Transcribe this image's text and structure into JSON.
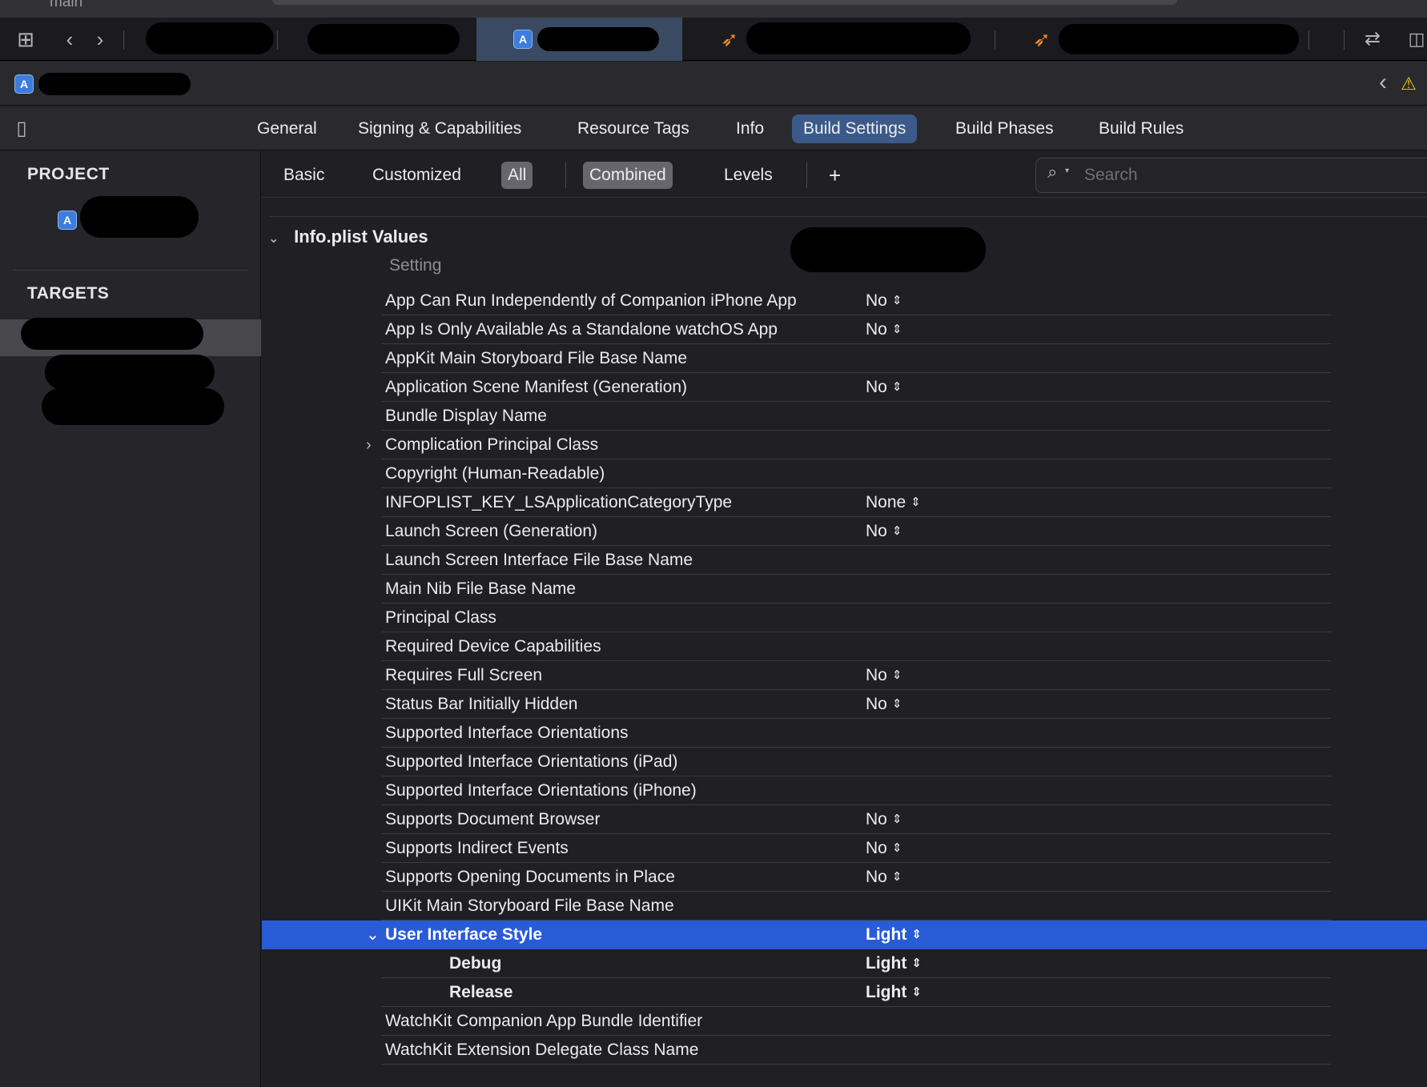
{
  "window": {
    "branch": "main"
  },
  "editor_tabs": [
    {
      "label": "General",
      "selected": false
    },
    {
      "label": "Signing & Capabilities",
      "selected": false
    },
    {
      "label": "Resource Tags",
      "selected": false
    },
    {
      "label": "Info",
      "selected": false
    },
    {
      "label": "Build Settings",
      "selected": true
    },
    {
      "label": "Build Phases",
      "selected": false
    },
    {
      "label": "Build Rules",
      "selected": false
    }
  ],
  "sidebar": {
    "project_header": "PROJECT",
    "targets_header": "TARGETS"
  },
  "filters": {
    "basic": "Basic",
    "customized": "Customized",
    "all": "All",
    "combined": "Combined",
    "levels": "Levels",
    "add": "+",
    "selected_scope": "All",
    "selected_view": "Combined"
  },
  "search": {
    "placeholder": "Search",
    "value": ""
  },
  "group": {
    "title": "Info.plist Values",
    "column_header": "Setting"
  },
  "settings": [
    {
      "name": "App Can Run Independently of Companion iPhone App",
      "value": "No"
    },
    {
      "name": "App Is Only Available As a Standalone watchOS App",
      "value": "No"
    },
    {
      "name": "AppKit Main Storyboard File Base Name",
      "value": ""
    },
    {
      "name": "Application Scene Manifest (Generation)",
      "value": "No"
    },
    {
      "name": "Bundle Display Name",
      "value": ""
    },
    {
      "name": "Complication Principal Class",
      "value": "",
      "expandable": true
    },
    {
      "name": "Copyright (Human-Readable)",
      "value": ""
    },
    {
      "name": "INFOPLIST_KEY_LSApplicationCategoryType",
      "value": "None"
    },
    {
      "name": "Launch Screen (Generation)",
      "value": "No"
    },
    {
      "name": "Launch Screen Interface File Base Name",
      "value": ""
    },
    {
      "name": "Main Nib File Base Name",
      "value": ""
    },
    {
      "name": "Principal Class",
      "value": ""
    },
    {
      "name": "Required Device Capabilities",
      "value": ""
    },
    {
      "name": "Requires Full Screen",
      "value": "No"
    },
    {
      "name": "Status Bar Initially Hidden",
      "value": "No"
    },
    {
      "name": "Supported Interface Orientations",
      "value": ""
    },
    {
      "name": "Supported Interface Orientations (iPad)",
      "value": ""
    },
    {
      "name": "Supported Interface Orientations (iPhone)",
      "value": ""
    },
    {
      "name": "Supports Document Browser",
      "value": "No"
    },
    {
      "name": "Supports Indirect Events",
      "value": "No"
    },
    {
      "name": "Supports Opening Documents in Place",
      "value": "No"
    },
    {
      "name": "UIKit Main Storyboard File Base Name",
      "value": ""
    },
    {
      "name": "User Interface Style",
      "value": "Light",
      "expanded": true,
      "selected": true
    },
    {
      "name": "Debug",
      "value": "Light",
      "sub": true
    },
    {
      "name": "Release",
      "value": "Light",
      "sub": true
    },
    {
      "name": "WatchKit Companion App Bundle Identifier",
      "value": ""
    },
    {
      "name": "WatchKit Extension Delegate Class Name",
      "value": ""
    }
  ],
  "colors": {
    "selection": "#2a5bd7",
    "active_tab": "#3b5a89",
    "background": "#1f1f24"
  }
}
